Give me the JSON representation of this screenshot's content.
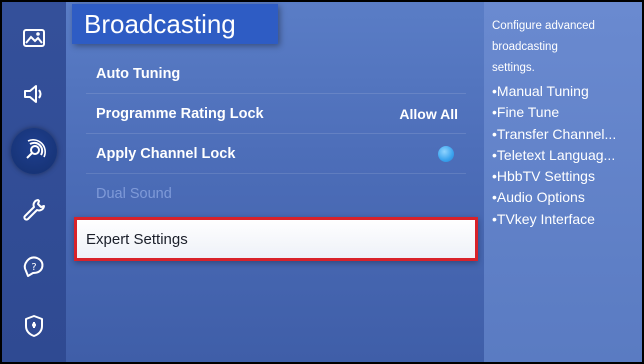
{
  "header": {
    "title": "Broadcasting"
  },
  "sidebar": {
    "items": [
      {
        "icon": "picture-icon",
        "active": false
      },
      {
        "icon": "sound-icon",
        "active": false
      },
      {
        "icon": "broadcasting-icon",
        "active": true
      },
      {
        "icon": "general-wrench-icon",
        "active": false
      },
      {
        "icon": "support-icon",
        "active": false
      },
      {
        "icon": "privacy-shield-icon",
        "active": false
      }
    ]
  },
  "menu": {
    "items": [
      {
        "label": "Auto Tuning",
        "value": ""
      },
      {
        "label": "Programme Rating Lock",
        "value": "Allow All"
      },
      {
        "label": "Apply Channel Lock",
        "toggle": "on"
      },
      {
        "label": "Dual Sound",
        "disabled": true
      }
    ],
    "selected": {
      "label": "Expert Settings"
    }
  },
  "help": {
    "description": "Configure advanced broadcasting settings.",
    "items": [
      "•Manual Tuning",
      "•Fine Tune",
      "•Transfer Channel...",
      "•Teletext Languag...",
      "•HbbTV Settings",
      "•Audio Options",
      "•TVkey Interface"
    ]
  },
  "colors": {
    "accent": "#2e5cc4",
    "selection_border": "#d8222a",
    "toggle_on": "#3aa3ee"
  }
}
